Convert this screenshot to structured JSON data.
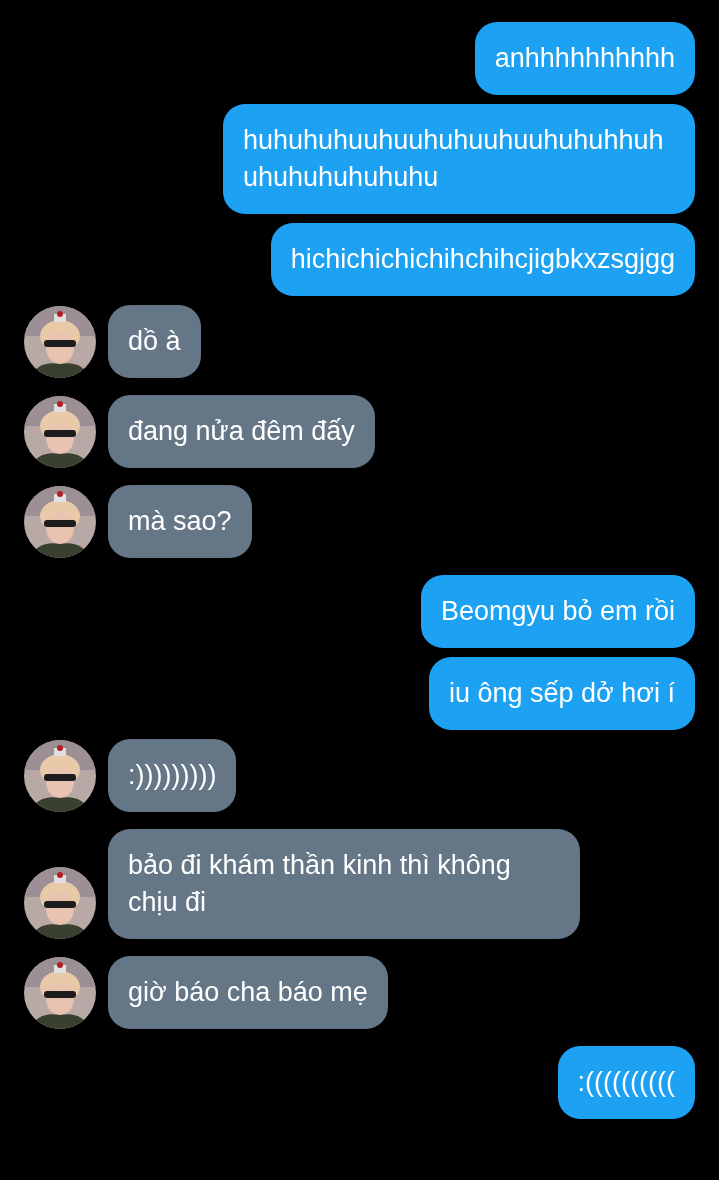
{
  "messages": [
    {
      "kind": "sent",
      "text": "anhhhhhhhhhh"
    },
    {
      "kind": "sent",
      "text": "huhuhuhuuhuuhuhuuhuuhuhuhhuhuhuhuhuhuhuhu"
    },
    {
      "kind": "sent",
      "text": "hichichichichihchihcjigbkxzsgjgg"
    },
    {
      "kind": "received",
      "text": "dồ à"
    },
    {
      "kind": "received",
      "text": "đang nửa đêm đấy"
    },
    {
      "kind": "received",
      "text": "mà sao?"
    },
    {
      "kind": "sent",
      "text": "Beomgyu bỏ em rồi"
    },
    {
      "kind": "sent",
      "text": "iu ông sếp dở hơi í"
    },
    {
      "kind": "received",
      "text": ":)))))))))"
    },
    {
      "kind": "received",
      "text": "bảo đi khám thần kinh thì không chịu đi"
    },
    {
      "kind": "received",
      "text": "giờ báo cha báo mẹ"
    },
    {
      "kind": "sent",
      "text": ":(((((((((("
    }
  ]
}
